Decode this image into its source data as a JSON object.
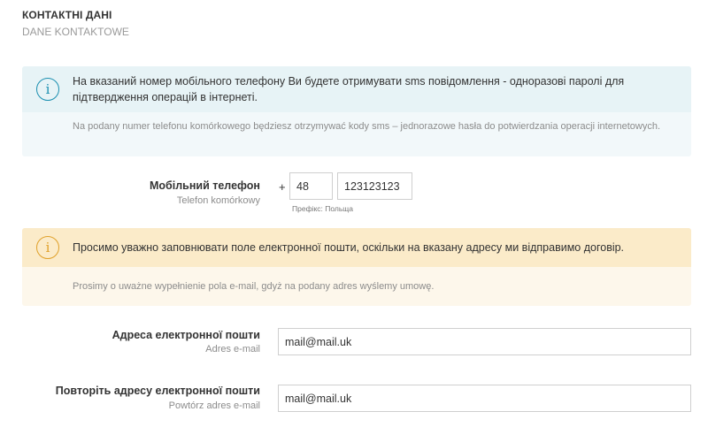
{
  "section": {
    "title": "КОНТАКТНІ ДАНІ",
    "subtitle": "DANE KONTAKTOWE"
  },
  "phone_notice": {
    "icon": "info-icon",
    "color": "#1b8fb0",
    "text_ua": "На вказаний номер мобільного телефону Ви будете отримувати sms повідомлення - одноразові паролі для підтвердження операцій в інтернеті.",
    "text_pl": "Na podany numer telefonu komórkowego będziesz otrzymywać kody sms – jednorazowe hasła do potwierdzania operacji internetowych."
  },
  "phone": {
    "label_ua": "Мобільний телефон",
    "label_pl": "Telefon komórkowy",
    "plus": "+",
    "prefix_value": "48",
    "number_value": "123123123",
    "hint": "Префікс: Польща"
  },
  "email_notice": {
    "icon": "info-icon",
    "color": "#e0a12a",
    "text_ua": "Просимо уважно заповнювати поле електронної пошти, оскільки на вказану адресу ми відправимо договір.",
    "text_pl": "Prosimy o uważne wypełnienie pola e-mail, gdyż na podany adres wyślemy umowę."
  },
  "email": {
    "label_ua": "Адреса електронної пошти",
    "label_pl": "Adres e-mail",
    "value": "mail@mail.uk"
  },
  "email_repeat": {
    "label_ua": "Повторіть адресу електронної пошти",
    "label_pl": "Powtórz adres e-mail",
    "value": "mail@mail.uk"
  }
}
